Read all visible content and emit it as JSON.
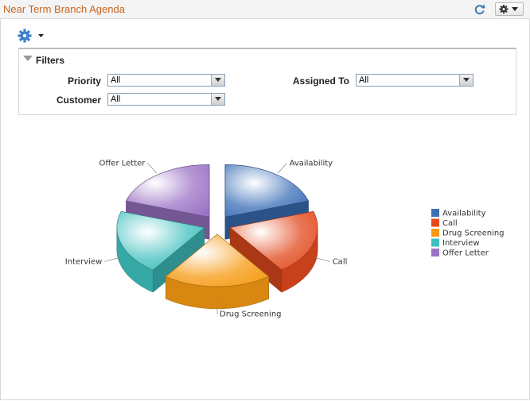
{
  "header": {
    "title": "Near Term Branch Agenda",
    "refresh_icon": "refresh-icon",
    "settings_icon": "gear-icon"
  },
  "toolbar": {
    "actions_icon": "gear-icon"
  },
  "filters": {
    "title": "Filters",
    "priority_label": "Priority",
    "priority_value": "All",
    "assigned_label": "Assigned To",
    "assigned_value": "All",
    "customer_label": "Customer",
    "customer_value": "All"
  },
  "chart_data": {
    "type": "pie",
    "categories": [
      "Availability",
      "Call",
      "Drug Screening",
      "Interview",
      "Offer Letter"
    ],
    "values": [
      20,
      20,
      20,
      20,
      20
    ],
    "colors": [
      "#3b6fb6",
      "#e24a1e",
      "#f59a12",
      "#3dbfbd",
      "#9b72c4"
    ],
    "legend_position": "right",
    "exploded": true,
    "three_d": true
  }
}
